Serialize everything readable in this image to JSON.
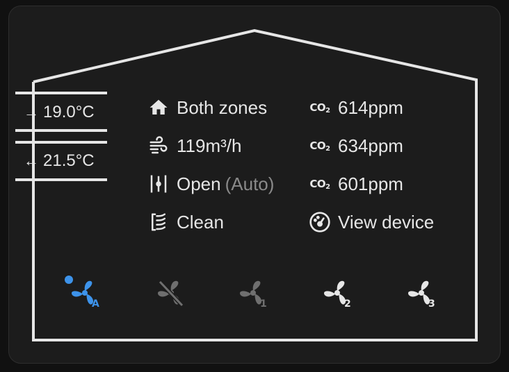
{
  "temperatures": {
    "supply": {
      "arrow": "→",
      "value": "19.0°C"
    },
    "extract": {
      "arrow": "←",
      "value": "21.5°C"
    }
  },
  "status": {
    "zones": "Both zones",
    "airflow": "119m³/h",
    "bypass": "Open",
    "bypass_mode": "(Auto)",
    "filter": "Clean"
  },
  "co2": {
    "label": "CO",
    "subscript": "2",
    "readings": [
      "614ppm",
      "634ppm",
      "601ppm"
    ]
  },
  "device": {
    "link_label": "View device"
  },
  "fan_modes": [
    {
      "name": "auto",
      "badge": "A",
      "active": true
    },
    {
      "name": "off",
      "badge": "",
      "active": false
    },
    {
      "name": "speed-1",
      "badge": "1",
      "active": false
    },
    {
      "name": "speed-2",
      "badge": "2",
      "active": false
    },
    {
      "name": "speed-3",
      "badge": "3",
      "active": false
    }
  ],
  "colors": {
    "active": "#3d93ea",
    "text": "#e6e6e6",
    "muted": "#8a8a8a",
    "dim": "#6f6f6f",
    "background": "#1c1c1c"
  }
}
